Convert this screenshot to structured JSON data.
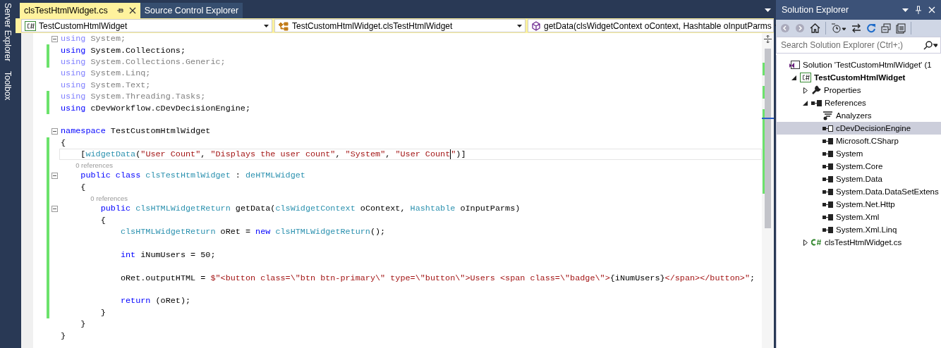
{
  "side_tabs": [
    "Server Explorer",
    "Toolbox"
  ],
  "doc_tabs": [
    {
      "label": "clsTestHtmlWidget.cs",
      "selected": true
    },
    {
      "label": "Source Control Explorer",
      "selected": false
    }
  ],
  "nav_bar": [
    {
      "kind": "project",
      "text": "TestCustomHtmlWidget"
    },
    {
      "kind": "class",
      "text": "TestCustomHtmlWidget.clsTestHtmlWidget"
    },
    {
      "kind": "method",
      "text": "getData(clsWidgetContext oContext, Hashtable oInputParms"
    }
  ],
  "code_lines": [
    {
      "kind": "code",
      "changed": false,
      "faded": true,
      "fold": true,
      "current": false,
      "tokens": [
        {
          "text": "using",
          "kind": "kw"
        },
        {
          "text": " System;",
          "kind": "plain"
        }
      ]
    },
    {
      "kind": "code",
      "changed": true,
      "faded": false,
      "fold": false,
      "current": false,
      "tokens": [
        {
          "text": "using",
          "kind": "kw"
        },
        {
          "text": " System.Collections;",
          "kind": "plain"
        }
      ]
    },
    {
      "kind": "code",
      "changed": true,
      "faded": true,
      "fold": false,
      "current": false,
      "tokens": [
        {
          "text": "using",
          "kind": "kw"
        },
        {
          "text": " System.Collections.Generic;",
          "kind": "plain"
        }
      ]
    },
    {
      "kind": "code",
      "changed": false,
      "faded": true,
      "fold": false,
      "current": false,
      "tokens": [
        {
          "text": "using",
          "kind": "kw"
        },
        {
          "text": " System.Linq;",
          "kind": "plain"
        }
      ]
    },
    {
      "kind": "code",
      "changed": false,
      "faded": true,
      "fold": false,
      "current": false,
      "tokens": [
        {
          "text": "using",
          "kind": "kw"
        },
        {
          "text": " System.Text;",
          "kind": "plain"
        }
      ]
    },
    {
      "kind": "code",
      "changed": true,
      "faded": true,
      "fold": false,
      "current": false,
      "tokens": [
        {
          "text": "using",
          "kind": "kw"
        },
        {
          "text": " System.Threading.Tasks;",
          "kind": "plain"
        }
      ]
    },
    {
      "kind": "code",
      "changed": true,
      "faded": false,
      "fold": false,
      "current": false,
      "tokens": [
        {
          "text": "using",
          "kind": "kw"
        },
        {
          "text": " cDevWorkflow.cDevDecisionEngine;",
          "kind": "plain"
        }
      ]
    },
    {
      "kind": "blank",
      "changed": false
    },
    {
      "kind": "code",
      "changed": false,
      "faded": false,
      "fold": true,
      "current": false,
      "tokens": [
        {
          "text": "namespace",
          "kind": "kw"
        },
        {
          "text": " TestCustomHtmlWidget",
          "kind": "plain"
        }
      ]
    },
    {
      "kind": "code",
      "changed": true,
      "faded": false,
      "fold": false,
      "current": false,
      "tokens": [
        {
          "text": "{",
          "kind": "plain"
        }
      ]
    },
    {
      "kind": "code",
      "changed": true,
      "faded": false,
      "fold": false,
      "current": true,
      "tokens": [
        {
          "text": "    [",
          "kind": "plain"
        },
        {
          "text": "widgetData",
          "kind": "type"
        },
        {
          "text": "(",
          "kind": "plain"
        },
        {
          "text": "\"User Count\"",
          "kind": "str"
        },
        {
          "text": ", ",
          "kind": "plain"
        },
        {
          "text": "\"Displays the user count\"",
          "kind": "str"
        },
        {
          "text": ", ",
          "kind": "plain"
        },
        {
          "text": "\"System\"",
          "kind": "str"
        },
        {
          "text": ", ",
          "kind": "plain"
        },
        {
          "text": "\"User Count",
          "kind": "str",
          "caret_after": true
        },
        {
          "text": "\"",
          "kind": "str"
        },
        {
          "text": ")]",
          "kind": "plain"
        }
      ]
    },
    {
      "kind": "lens",
      "changed": true,
      "text": "0 references"
    },
    {
      "kind": "code",
      "changed": true,
      "faded": false,
      "fold": true,
      "current": false,
      "tokens": [
        {
          "text": "    public class ",
          "kind": "kw"
        },
        {
          "text": "clsTestHtmlWidget",
          "kind": "type"
        },
        {
          "text": " : ",
          "kind": "plain"
        },
        {
          "text": "deHTMLWidget",
          "kind": "type"
        }
      ]
    },
    {
      "kind": "code",
      "changed": true,
      "faded": false,
      "fold": false,
      "current": false,
      "tokens": [
        {
          "text": "    {",
          "kind": "plain"
        }
      ]
    },
    {
      "kind": "lens",
      "changed": true,
      "text": "0 references"
    },
    {
      "kind": "code",
      "changed": true,
      "faded": false,
      "fold": true,
      "current": false,
      "tokens": [
        {
          "text": "        public ",
          "kind": "kw"
        },
        {
          "text": "clsHTMLWidgetReturn",
          "kind": "type"
        },
        {
          "text": " getData(",
          "kind": "plain"
        },
        {
          "text": "clsWidgetContext",
          "kind": "type"
        },
        {
          "text": " oContext, ",
          "kind": "plain"
        },
        {
          "text": "Hashtable",
          "kind": "type"
        },
        {
          "text": " oInputParms)",
          "kind": "plain"
        }
      ]
    },
    {
      "kind": "code",
      "changed": true,
      "faded": false,
      "fold": false,
      "current": false,
      "tokens": [
        {
          "text": "        {",
          "kind": "plain"
        }
      ]
    },
    {
      "kind": "code",
      "changed": true,
      "faded": false,
      "fold": false,
      "current": false,
      "tokens": [
        {
          "text": "            clsHTMLWidgetReturn",
          "kind": "type"
        },
        {
          "text": " oRet = ",
          "kind": "plain"
        },
        {
          "text": "new ",
          "kind": "kw"
        },
        {
          "text": "clsHTMLWidgetReturn",
          "kind": "type"
        },
        {
          "text": "();",
          "kind": "plain"
        }
      ]
    },
    {
      "kind": "blank",
      "changed": true
    },
    {
      "kind": "code",
      "changed": true,
      "faded": false,
      "fold": false,
      "current": false,
      "tokens": [
        {
          "text": "            int",
          "kind": "kw"
        },
        {
          "text": " iNumUsers = 50;",
          "kind": "plain"
        }
      ]
    },
    {
      "kind": "blank",
      "changed": true
    },
    {
      "kind": "code",
      "changed": true,
      "faded": false,
      "fold": false,
      "current": false,
      "tokens": [
        {
          "text": "            oRet.outputHTML = ",
          "kind": "plain"
        },
        {
          "text": "$\"<button class=\\\"btn btn-primary\\\" type=\\\"button\\\">Users <span class=\\\"badge\\\">",
          "kind": "str"
        },
        {
          "text": "{iNumUsers}",
          "kind": "plain"
        },
        {
          "text": "</span></button>\"",
          "kind": "str"
        },
        {
          "text": ";",
          "kind": "plain"
        }
      ]
    },
    {
      "kind": "blank",
      "changed": true
    },
    {
      "kind": "code",
      "changed": true,
      "faded": false,
      "fold": false,
      "current": false,
      "tokens": [
        {
          "text": "            return",
          "kind": "kw"
        },
        {
          "text": " (oRet);",
          "kind": "plain"
        }
      ]
    },
    {
      "kind": "code",
      "changed": true,
      "faded": false,
      "fold": false,
      "current": false,
      "tokens": [
        {
          "text": "        }",
          "kind": "plain"
        }
      ]
    },
    {
      "kind": "code",
      "changed": false,
      "faded": false,
      "fold": false,
      "current": false,
      "tokens": [
        {
          "text": "    }",
          "kind": "plain"
        }
      ]
    },
    {
      "kind": "code",
      "changed": false,
      "faded": false,
      "fold": false,
      "current": false,
      "tokens": [
        {
          "text": "}",
          "kind": "plain"
        }
      ]
    }
  ],
  "solution_explorer": {
    "title": "Solution Explorer",
    "search": {
      "placeholder": "Search Solution Explorer (Ctrl+;)"
    },
    "tree": [
      {
        "kind": "solution",
        "label": "Solution 'TestCustomHtmlWidget' (1",
        "selected": false,
        "children": [
          {
            "kind": "project",
            "label": "TestCustomHtmlWidget",
            "selected": false,
            "expanded": true,
            "children": [
              {
                "kind": "properties",
                "label": "Properties",
                "selected": false,
                "expanded": false
              },
              {
                "kind": "references",
                "label": "References",
                "selected": false,
                "expanded": true,
                "children": [
                  {
                    "kind": "analyzers",
                    "label": "Analyzers",
                    "selected": false
                  },
                  {
                    "kind": "reference",
                    "label": "cDevDecisionEngine",
                    "selected": true
                  },
                  {
                    "kind": "reference",
                    "label": "Microsoft.CSharp",
                    "selected": false
                  },
                  {
                    "kind": "reference",
                    "label": "System",
                    "selected": false
                  },
                  {
                    "kind": "reference",
                    "label": "System.Core",
                    "selected": false
                  },
                  {
                    "kind": "reference",
                    "label": "System.Data",
                    "selected": false
                  },
                  {
                    "kind": "reference",
                    "label": "System.Data.DataSetExtens",
                    "selected": false
                  },
                  {
                    "kind": "reference",
                    "label": "System.Net.Http",
                    "selected": false
                  },
                  {
                    "kind": "reference",
                    "label": "System.Xml",
                    "selected": false
                  },
                  {
                    "kind": "reference",
                    "label": "System.Xml.Linq",
                    "selected": false
                  }
                ]
              },
              {
                "kind": "csfile",
                "label": "clsTestHtmlWidget.cs",
                "selected": false,
                "expanded": false
              }
            ]
          }
        ]
      }
    ]
  }
}
